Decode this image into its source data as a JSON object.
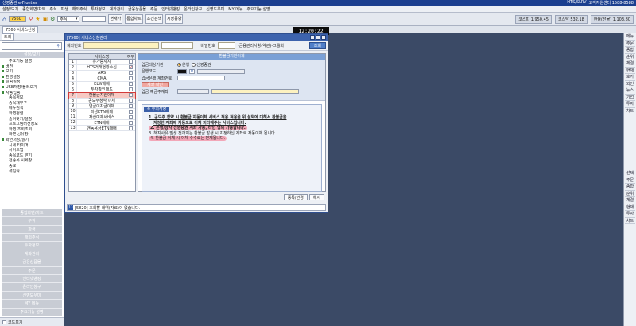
{
  "app": {
    "title": "신영증권 e-Frontier",
    "right_info": [
      "HTS/SLRV",
      "고객지원센터 1588-8588"
    ]
  },
  "menu": [
    "설정/보기",
    "종합화면/차트",
    "주식",
    "파생",
    "해외주식",
    "투자정보",
    "계좌관리",
    "금융상품몰",
    "주문",
    "인터넷뱅킹",
    "온라인창구",
    "신영도우미",
    "MY 메뉴",
    "주요기능 설명"
  ],
  "toolbar": {
    "screen_no": "7560",
    "type": "주식",
    "buttons": [
      "현재가",
      "통합차트",
      "조건검색",
      "시장동향"
    ],
    "ticker": [
      "코스피 1,950.45",
      "코스닥 532.18",
      "환율(선물) 1,103.80"
    ],
    "sub_screen": "7560 서비스신청"
  },
  "clock": "12:20:22",
  "left": {
    "tab": "트리",
    "category": "설정/보기",
    "tree": [
      {
        "label": "주요기능 설명",
        "sq": false,
        "indent": true
      },
      {
        "label": "버전",
        "sq": true,
        "indent": false
      },
      {
        "label": "보기",
        "sq": true,
        "indent": false
      },
      {
        "label": "환경설정",
        "sq": true,
        "indent": false
      },
      {
        "label": "알림설정",
        "sq": true,
        "indent": false
      },
      {
        "label": "USB저장/불러오기",
        "sq": true,
        "indent": false
      },
      {
        "label": "자동업종",
        "sq": true,
        "indent": false
      },
      {
        "label": "종목정보",
        "sq": false,
        "indent": true
      },
      {
        "label": "종목재무구",
        "sq": false,
        "indent": true
      },
      {
        "label": "메뉴검색",
        "sq": false,
        "indent": true
      },
      {
        "label": "화면정렬",
        "sq": false,
        "indent": true
      },
      {
        "label": "즐겨찾기/설정",
        "sq": false,
        "indent": true
      },
      {
        "label": "프로그램버전정보",
        "sq": false,
        "indent": true
      },
      {
        "label": "화면 조회조회",
        "sq": false,
        "indent": true
      },
      {
        "label": "화면 공유창",
        "sq": false,
        "indent": true
      },
      {
        "label": "화면저장/읽기",
        "sq": true,
        "indent": false
      },
      {
        "label": "시세 타이머",
        "sq": false,
        "indent": true
      },
      {
        "label": "사이트맵",
        "sq": false,
        "indent": true
      },
      {
        "label": "종목코드 받기",
        "sq": false,
        "indent": true
      },
      {
        "label": "전종목 시세창",
        "sq": false,
        "indent": true
      },
      {
        "label": "종료",
        "sq": false,
        "indent": true
      },
      {
        "label": "재접속",
        "sq": false,
        "indent": true
      }
    ],
    "nav": [
      "종합화면/차트",
      "주식",
      "파생",
      "해외주식",
      "투자정보",
      "계좌관리",
      "금융상품몰",
      "주문",
      "인터넷뱅킹",
      "온라인창구",
      "신영도우미",
      "MY 메뉴",
      "주요기능 설명"
    ],
    "bottom_label": "코드보기"
  },
  "right": {
    "items": [
      "메뉴",
      "주문",
      "종합",
      "순위",
      "체결",
      "현재",
      "호가",
      "외인",
      "뉴스",
      "기업",
      "투자",
      "차트"
    ],
    "items2": [
      "선택",
      "주문",
      "종합",
      "순위",
      "체결",
      "현재",
      "투자",
      "차트"
    ]
  },
  "win": {
    "title": "[7560] 서비스신청관리",
    "acc_label": "계좌번호",
    "pw_label": "비밀번호",
    "pw_info": "-금융관리사항(약관)-그룹회",
    "query": "조회",
    "svc_head": [
      "서비스명",
      "여부"
    ],
    "services": [
      {
        "no": "1",
        "name": "유가증사지",
        "on": false
      },
      {
        "no": "2",
        "name": "HTS거래현황수신",
        "on": true
      },
      {
        "no": "3",
        "name": "ARS",
        "on": false
      },
      {
        "no": "4",
        "name": "CMA",
        "on": false
      },
      {
        "no": "5",
        "name": "ELW매매",
        "on": false
      },
      {
        "no": "6",
        "name": "투자확인매도",
        "on": false
      },
      {
        "no": "7",
        "name": "환불금지원이체",
        "on": false,
        "sel": true
      },
      {
        "no": "8",
        "name": "공모주청약 이체",
        "on": false
      },
      {
        "no": "9",
        "name": "연금이자금이체",
        "on": false
      },
      {
        "no": "10",
        "name": "파생ETN매매",
        "on": false
      },
      {
        "no": "11",
        "name": "자산여재서비스",
        "on": false
      },
      {
        "no": "12",
        "name": "ETN매매",
        "on": false
      },
      {
        "no": "13",
        "name": "앤동용금ETN매매",
        "on": false
      }
    ],
    "detail_title": "환불금지원이체",
    "form": {
      "target_label": "입금대상기관",
      "target_opts": [
        "은행",
        "신영증권"
      ],
      "bank_label": "은행코드",
      "acc_label": "입금은행 계좌번호",
      "cert_btn": "계좌 확인",
      "holder_label": "입금 예금주계좌",
      "holder_value": "- -"
    },
    "notice_hd": "※ 주의사항",
    "notice": [
      "1. 공모주 청약 시 환불금 자동이체 서비스 적용 적용을 위 설약에 대해서 환불금을",
      "지정한 계좌에 자동으로 이체 처리해주는 서비스입니다.",
      "2. 은행/당사 신영증권 계좌 가능, 타인 명의 가능합니다.",
      "3. 해지사유 발생 전까지는 환불금 발생 시 지정하신 계좌로 자동이체 됩니다.",
      "4. 환불금 이체 시 이체 수수료는 면제됩니다."
    ],
    "btn_apply": "등록/변경",
    "btn_cancel": "해지",
    "status_code": "13",
    "status_text": "[5820] 조회할 내역(자료)이 없습니다."
  }
}
